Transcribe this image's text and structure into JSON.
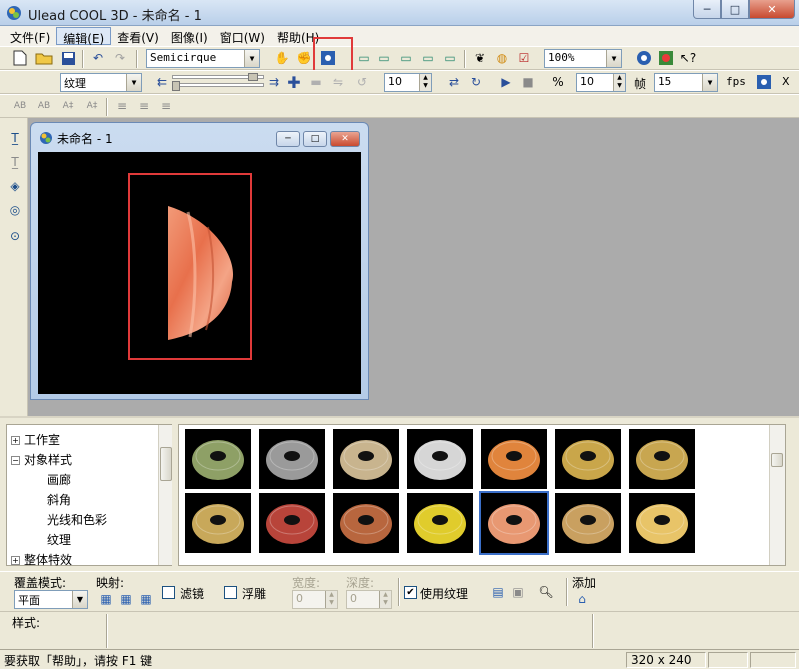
{
  "window": {
    "title": "Ulead COOL 3D - 未命名 - 1",
    "min_label": "─",
    "max_label": "□",
    "close_label": "✕"
  },
  "menu": [
    {
      "label": "文件(F)"
    },
    {
      "label": "编辑(E)"
    },
    {
      "label": "查看(V)"
    },
    {
      "label": "图像(I)"
    },
    {
      "label": "窗口(W)"
    },
    {
      "label": "帮助(H)"
    }
  ],
  "toolbar": {
    "font_value": "Semicirque",
    "zoom_value": "100%",
    "texture_value": "纹理",
    "spin_1_value": "10",
    "spin_2_value": "10",
    "frame_label": "帧",
    "frame_value": "15",
    "fps_label": "fps",
    "x_label": "X",
    "text_tools": [
      "AB",
      "AB",
      "A‡",
      "A‡"
    ]
  },
  "document": {
    "title": "未命名 - 1",
    "canvas_size": "320 x 240"
  },
  "tree": {
    "items": [
      {
        "label": "工作室",
        "expander": "+"
      },
      {
        "label": "对象样式",
        "expander": "−"
      },
      {
        "label": "画廊"
      },
      {
        "label": "斜角"
      },
      {
        "label": "光线和色彩"
      },
      {
        "label": "纹理"
      },
      {
        "label": "整体特效",
        "expander": "+"
      }
    ]
  },
  "gallery": {
    "colors": [
      [
        "#8ea066",
        "#9a9a9a",
        "#c8b48e",
        "#d6d6d6",
        "#e0843c",
        "#c9a64a",
        "#c8a650"
      ],
      [
        "#c8a85a",
        "#b8443a",
        "#b8663e",
        "#e0cc2c",
        "#e89872",
        "#c9a060",
        "#e8c468"
      ]
    ]
  },
  "props": {
    "overlay_label": "覆盖模式:",
    "overlay_value": "平面",
    "mapping_label": "映射:",
    "filter_label": "滤镜",
    "emboss_label": "浮雕",
    "width_label": "宽度:",
    "width_value": "0",
    "depth_label": "深度:",
    "depth_value": "0",
    "use_texture_label": "使用纹理",
    "use_texture_checked": "✔",
    "add_label": "添加"
  },
  "style": {
    "label": "样式:"
  },
  "status": {
    "help_text": "要获取「帮助」，请按 F1 键",
    "size": "320 x 240"
  }
}
